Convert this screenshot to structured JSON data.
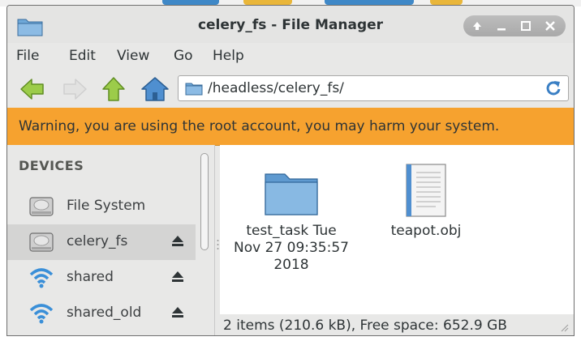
{
  "window": {
    "title": "celery_fs - File Manager",
    "buttons": [
      "up",
      "minimize",
      "maximize",
      "close"
    ]
  },
  "menubar": {
    "items": [
      {
        "label": "File"
      },
      {
        "label": "Edit"
      },
      {
        "label": "View"
      },
      {
        "label": "Go"
      },
      {
        "label": "Help"
      }
    ]
  },
  "toolbar": {
    "back_icon": "arrow-left-icon",
    "forward_icon": "arrow-right-icon",
    "up_icon": "arrow-up-icon",
    "home_icon": "home-icon",
    "location": "/headless/celery_fs/",
    "reload_icon": "reload-icon"
  },
  "warning": {
    "text": "Warning, you are using the root account, you may harm your system."
  },
  "sidebar": {
    "heading": "DEVICES",
    "items": [
      {
        "label": "File System",
        "icon": "drive-icon",
        "eject": false,
        "selected": false
      },
      {
        "label": "celery_fs",
        "icon": "drive-icon",
        "eject": true,
        "selected": true
      },
      {
        "label": "shared",
        "icon": "network-icon",
        "eject": true,
        "selected": false
      },
      {
        "label": "shared_old",
        "icon": "network-icon",
        "eject": true,
        "selected": false
      }
    ]
  },
  "files": [
    {
      "name": "test_task Tue Nov 27 09:35:57 2018",
      "lines": [
        "test_task Tue",
        "Nov 27 09:35:57",
        "2018"
      ],
      "icon": "folder-icon"
    },
    {
      "name": "teapot.obj",
      "lines": [
        "teapot.obj"
      ],
      "icon": "document-icon"
    }
  ],
  "statusbar": {
    "text": "2 items (210.6 kB), Free space: 652.9 GB"
  },
  "colors": {
    "warning_bg": "#f6a22f",
    "window_bg": "#e8e8e7",
    "arrow_green": "#8fc63c",
    "home_blue": "#3a7fc4"
  }
}
